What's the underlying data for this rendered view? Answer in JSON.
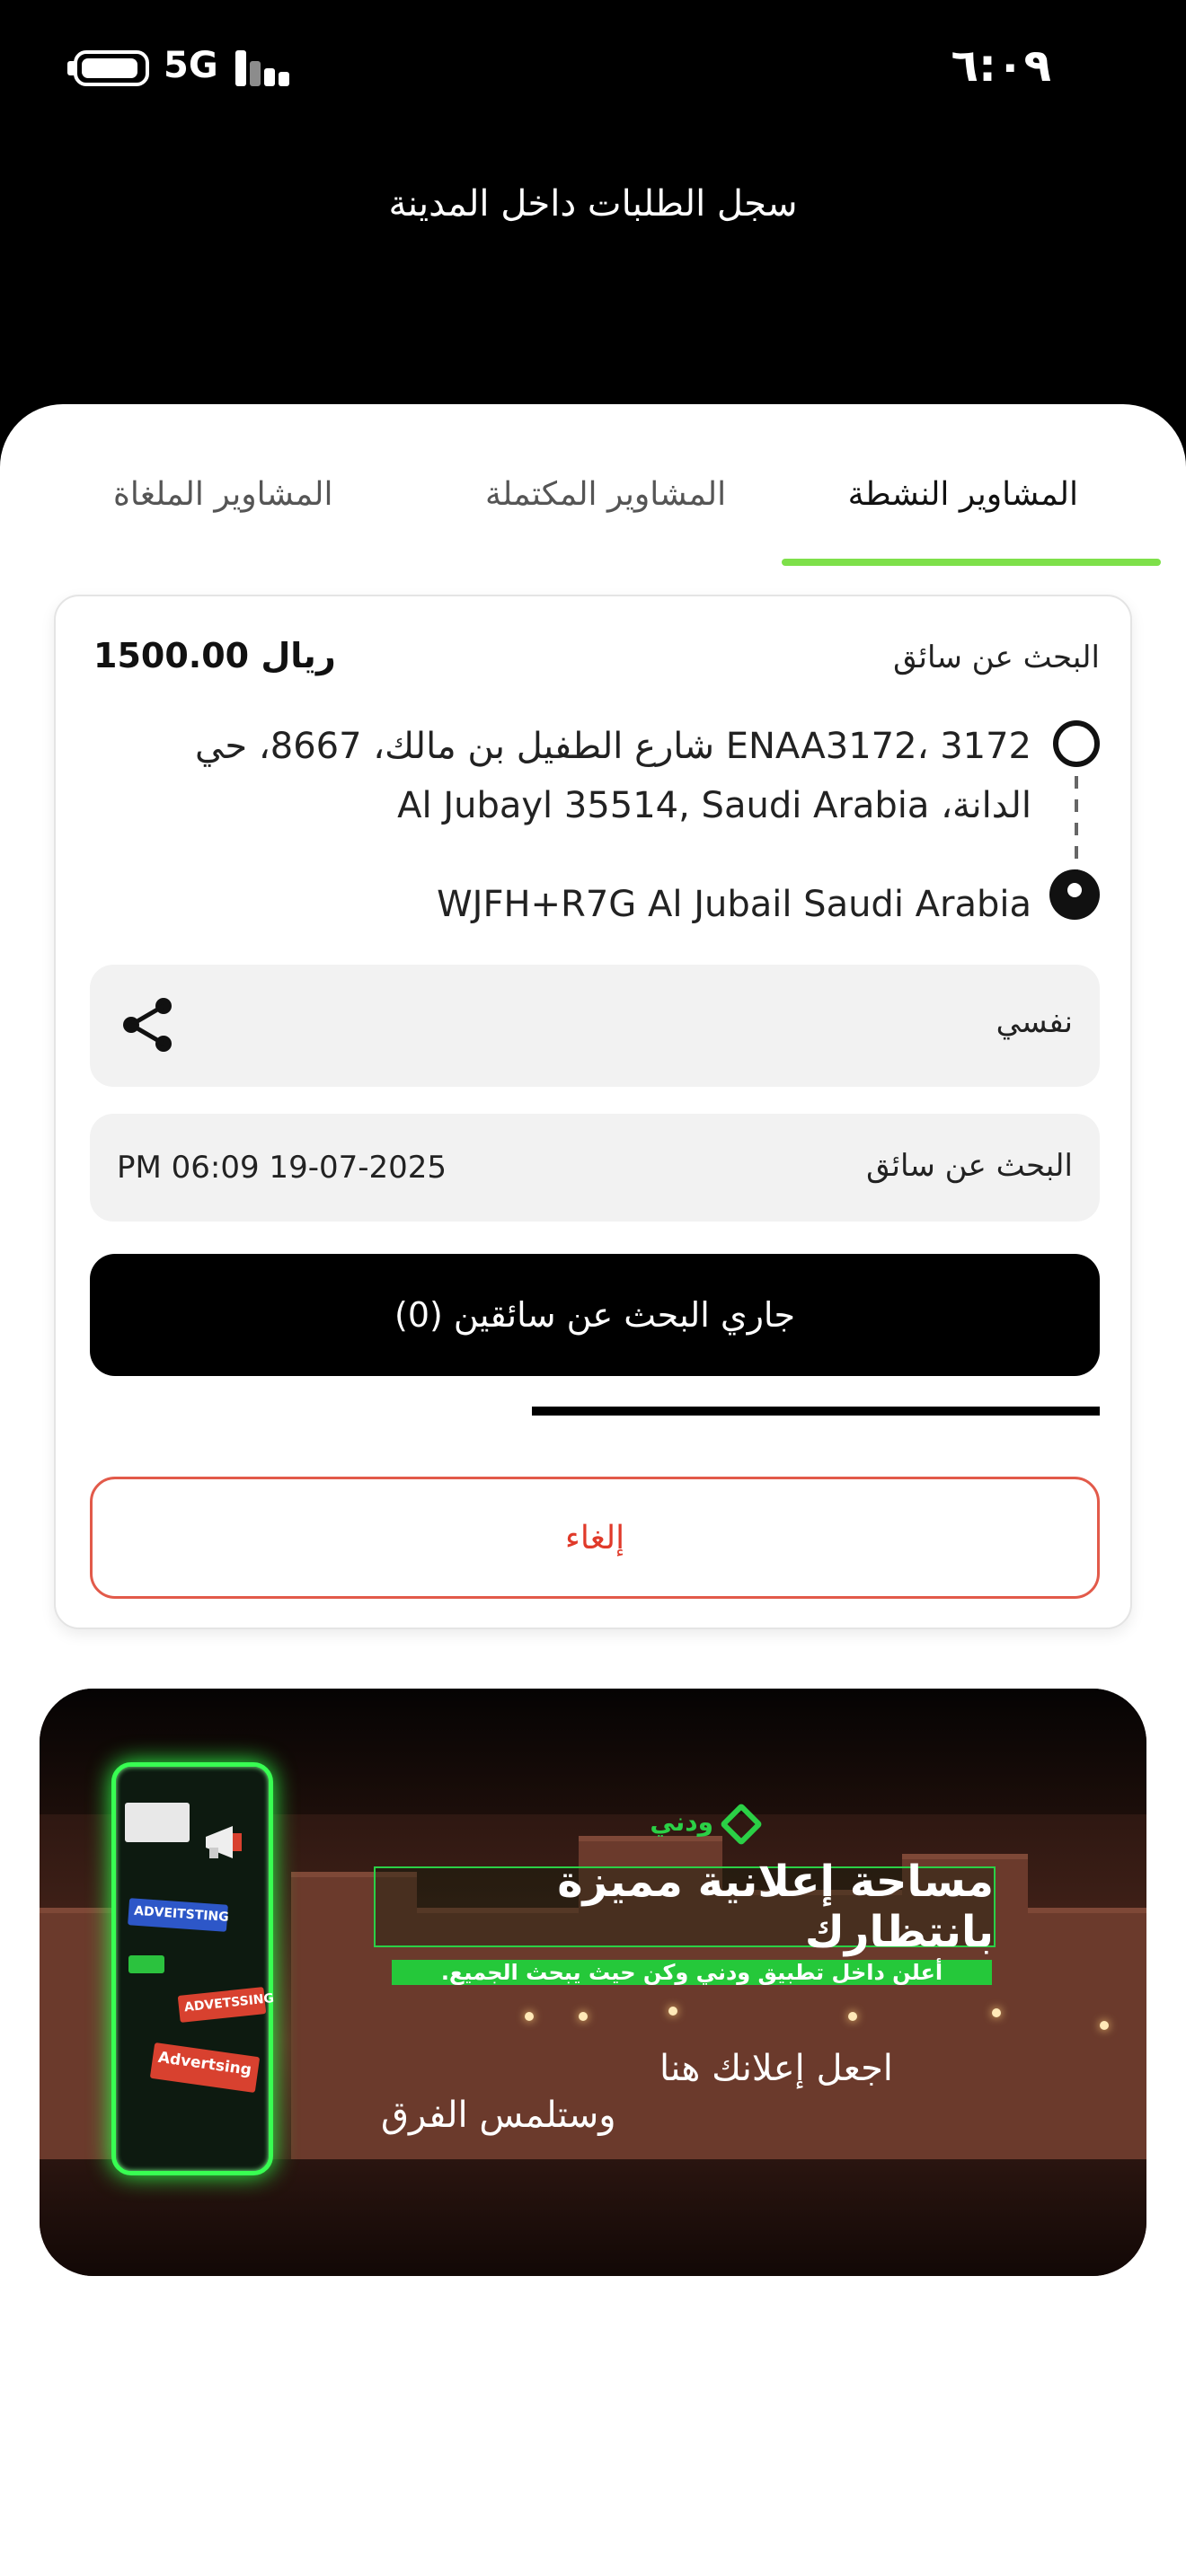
{
  "status_bar": {
    "network": "5G",
    "time": "٦:٠٩"
  },
  "header": {
    "title": "سجل الطلبات داخل المدينة"
  },
  "tabs": {
    "active": "المشاوير النشطة",
    "completed": "المشاوير المكتملة",
    "cancelled": "المشاوير الملغاة",
    "selected": "active"
  },
  "trip_card": {
    "status": "البحث عن سائق",
    "price": "1500.00 ريال",
    "pickup_address": "3172 ،ENAA3172 شارع الطفيل بن مالك، 8667، حي الدانة، Al Jubayl 35514, Saudi Arabia",
    "dropoff_address": "WJFH+R7G Al Jubail Saudi Arabia",
    "passenger_label": "نفسي",
    "datetime_label": "البحث عن سائق",
    "datetime_value": "PM 06:09 19-07-2025",
    "searching_button": "جاري البحث عن سائقين (0)",
    "cancel_button": "إلغاء"
  },
  "ad_banner": {
    "brand": "ودني",
    "headline": "مساحة إعلانية مميزة بانتظارك",
    "subline": "أعلن داخل تطبيق ودني وكن حيث يبحث الجميع.",
    "tagline_1": "اجعل إعلانك هنا",
    "tagline_2": "وستلمس الفرق",
    "phone_chip_1": "ADVEITSTING",
    "phone_chip_2": "ADVETSSING",
    "phone_chip_3": "Advertsing"
  },
  "colors": {
    "accent_green": "#7ee04a",
    "cancel_red": "#e03a2a",
    "brand_green": "#2bd046"
  }
}
